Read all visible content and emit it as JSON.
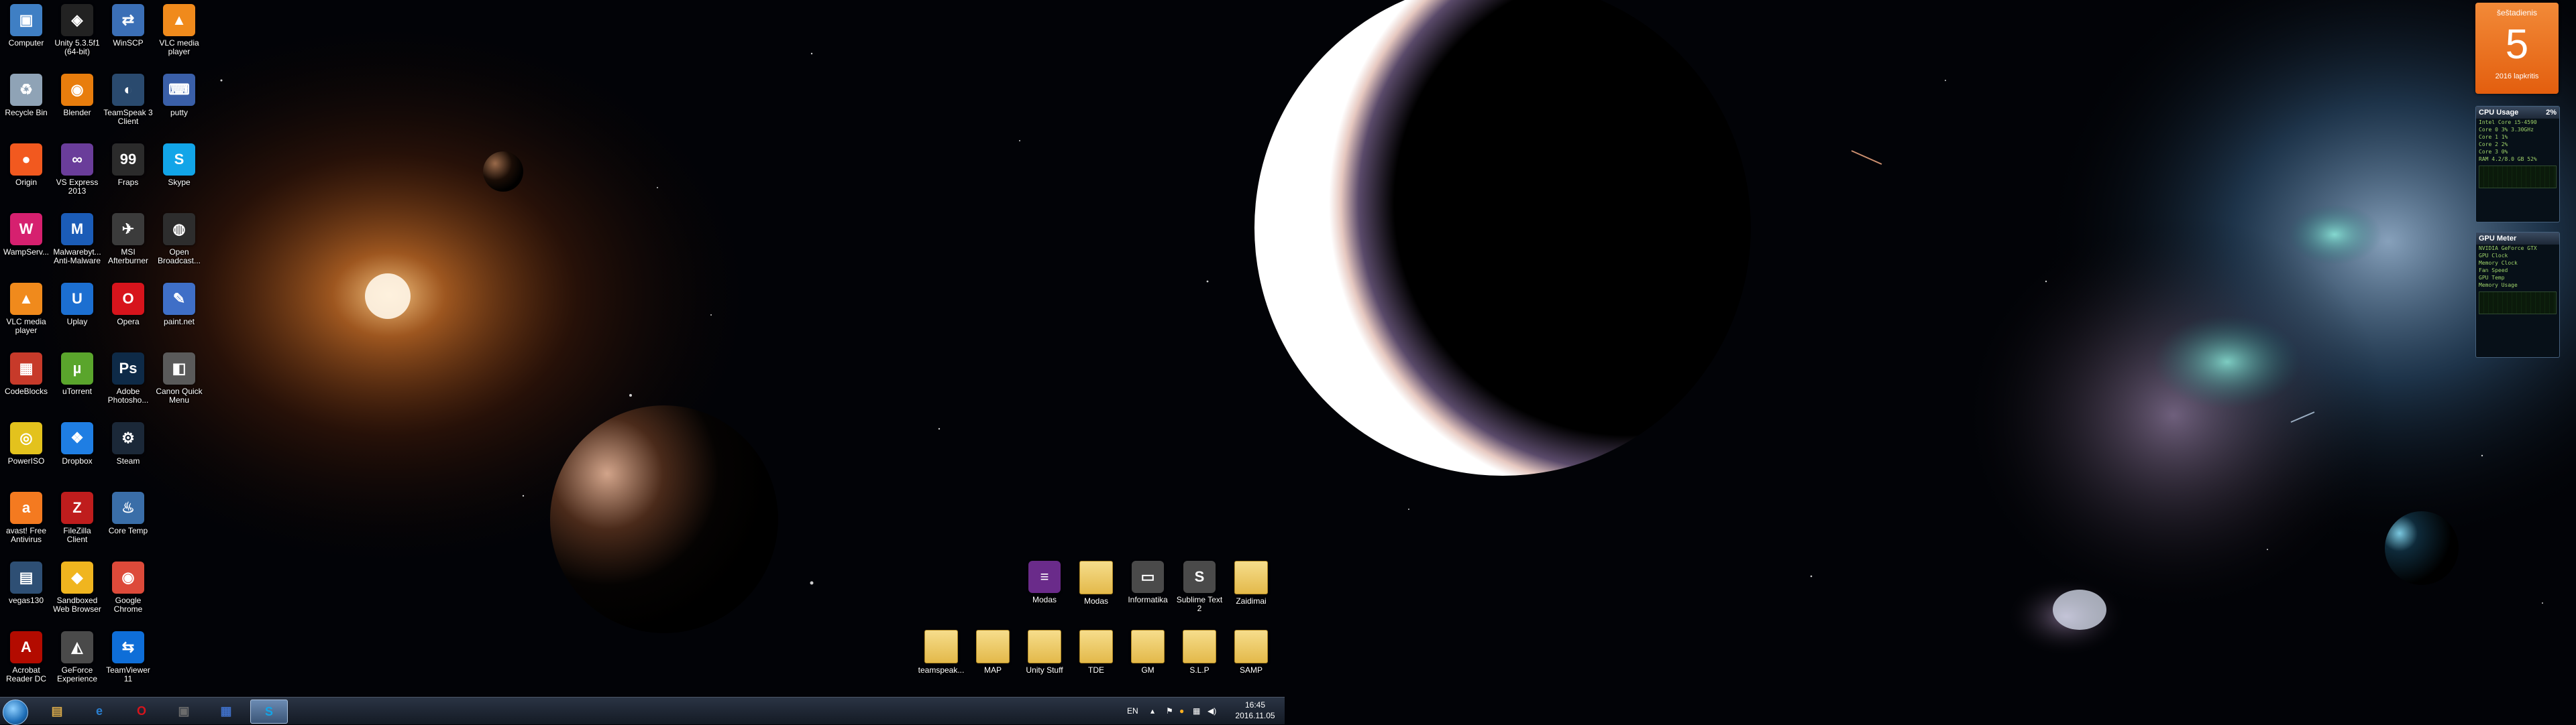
{
  "desktop": {
    "icons": [
      {
        "label": "Computer",
        "icon": "computer-icon",
        "color": "#3f7fc4",
        "glyph": "▣"
      },
      {
        "label": "Unity 5.3.5f1 (64-bit)",
        "icon": "unity-icon",
        "color": "#222222",
        "glyph": "◈"
      },
      {
        "label": "WinSCP",
        "icon": "winscp-icon",
        "color": "#3b6fb6",
        "glyph": "⇄"
      },
      {
        "label": "VLC media player",
        "icon": "vlc-icon",
        "color": "#f08a1c",
        "glyph": "▲"
      },
      {
        "label": "Recycle Bin",
        "icon": "recycle-bin-icon",
        "color": "#8fa3b6",
        "glyph": "♻"
      },
      {
        "label": "Blender",
        "icon": "blender-icon",
        "color": "#e87d0d",
        "glyph": "◉"
      },
      {
        "label": "TeamSpeak 3 Client",
        "icon": "teamspeak-icon",
        "color": "#2a4a6e",
        "glyph": "◐"
      },
      {
        "label": "putty",
        "icon": "putty-icon",
        "color": "#3a5fa8",
        "glyph": "⌨"
      },
      {
        "label": "Origin",
        "icon": "origin-icon",
        "color": "#f2591f",
        "glyph": "●"
      },
      {
        "label": "VS Express 2013",
        "icon": "visual-studio-icon",
        "color": "#6a3d9a",
        "glyph": "∞"
      },
      {
        "label": "Fraps",
        "icon": "fraps-icon",
        "color": "#2b2b2b",
        "glyph": "99"
      },
      {
        "label": "Skype",
        "icon": "skype-icon",
        "color": "#12a5e8",
        "glyph": "S"
      },
      {
        "label": "WampServ...",
        "icon": "wampserver-icon",
        "color": "#d6206f",
        "glyph": "W"
      },
      {
        "label": "Malwarebyt... Anti-Malware",
        "icon": "malwarebytes-icon",
        "color": "#1b5cb7",
        "glyph": "M"
      },
      {
        "label": "MSI Afterburner",
        "icon": "msi-afterburner-icon",
        "color": "#3b3b3b",
        "glyph": "✈"
      },
      {
        "label": "Open Broadcast...",
        "icon": "obs-icon",
        "color": "#2d2d2d",
        "glyph": "◍"
      },
      {
        "label": "VLC media player",
        "icon": "vlc-icon",
        "color": "#f08a1c",
        "glyph": "▲"
      },
      {
        "label": "Uplay",
        "icon": "uplay-icon",
        "color": "#1c6fd1",
        "glyph": "U"
      },
      {
        "label": "Opera",
        "icon": "opera-icon",
        "color": "#d7141c",
        "glyph": "O"
      },
      {
        "label": "paint.net",
        "icon": "paint-net-icon",
        "color": "#3f6fc7",
        "glyph": "✎"
      },
      {
        "label": "CodeBlocks",
        "icon": "codeblocks-icon",
        "color": "#c73a2a",
        "glyph": "▦"
      },
      {
        "label": "uTorrent",
        "icon": "utorrent-icon",
        "color": "#5aa52c",
        "glyph": "µ"
      },
      {
        "label": "Adobe Photosho...",
        "icon": "photoshop-icon",
        "color": "#0e2a47",
        "glyph": "Ps"
      },
      {
        "label": "Canon Quick Menu",
        "icon": "canon-icon",
        "color": "#5a5a5a",
        "glyph": "◧"
      },
      {
        "label": "PowerISO",
        "icon": "poweriso-icon",
        "color": "#e3c21d",
        "glyph": "◎"
      },
      {
        "label": "Dropbox",
        "icon": "dropbox-icon",
        "color": "#1f7ee3",
        "glyph": "❖"
      },
      {
        "label": "Steam",
        "icon": "steam-icon",
        "color": "#1b2838",
        "glyph": "⚙"
      },
      {
        "label": "",
        "icon": "blank",
        "color": "",
        "glyph": ""
      },
      {
        "label": "avast! Free Antivirus",
        "icon": "avast-icon",
        "color": "#f47a20",
        "glyph": "a"
      },
      {
        "label": "FileZilla Client",
        "icon": "filezilla-icon",
        "color": "#bf1d1d",
        "glyph": "Z"
      },
      {
        "label": "Core Temp",
        "icon": "core-temp-icon",
        "color": "#3a6ea8",
        "glyph": "♨"
      },
      {
        "label": "",
        "icon": "blank",
        "color": "",
        "glyph": ""
      },
      {
        "label": "vegas130",
        "icon": "vegas-icon",
        "color": "#2e4f74",
        "glyph": "▤"
      },
      {
        "label": "Sandboxed Web Browser",
        "icon": "sandboxie-icon",
        "color": "#f0b51f",
        "glyph": "◆"
      },
      {
        "label": "Google Chrome",
        "icon": "chrome-icon",
        "color": "#dd4a3a",
        "glyph": "◉"
      },
      {
        "label": "",
        "icon": "blank",
        "color": "",
        "glyph": ""
      },
      {
        "label": "Acrobat Reader DC",
        "icon": "acrobat-icon",
        "color": "#b30b00",
        "glyph": "A"
      },
      {
        "label": "GeForce Experience",
        "icon": "geforce-icon",
        "color": "#4a4a4a",
        "glyph": "◭"
      },
      {
        "label": "TeamViewer 11",
        "icon": "teamviewer-icon",
        "color": "#0e6ed8",
        "glyph": "⇆"
      },
      {
        "label": "",
        "icon": "blank",
        "color": "",
        "glyph": ""
      }
    ],
    "cluster_top": [
      {
        "label": "Modas",
        "icon": "winrar-icon",
        "type": "app",
        "color": "#6a2b8a",
        "glyph": "≡"
      },
      {
        "label": "Modas",
        "icon": "folder-icon",
        "type": "folder",
        "glyph": ""
      },
      {
        "label": "Informatika",
        "icon": "folder-icon",
        "type": "app",
        "color": "#4a4a4a",
        "glyph": "▭"
      },
      {
        "label": "Sublime Text 2",
        "icon": "sublime-icon",
        "type": "app",
        "color": "#4a4a4a",
        "glyph": "S"
      },
      {
        "label": "Zaidimai",
        "icon": "folder-icon",
        "type": "folder",
        "glyph": ""
      }
    ],
    "cluster_bottom": [
      {
        "label": "teamspeak...",
        "icon": "folder-icon",
        "type": "folder"
      },
      {
        "label": "MAP",
        "icon": "folder-icon",
        "type": "folder"
      },
      {
        "label": "Unity Stuff",
        "icon": "folder-icon",
        "type": "folder"
      },
      {
        "label": "TDE",
        "icon": "folder-icon",
        "type": "folder"
      },
      {
        "label": "GM",
        "icon": "folder-icon",
        "type": "folder"
      },
      {
        "label": "S.L.P",
        "icon": "folder-icon",
        "type": "folder"
      },
      {
        "label": "SAMP",
        "icon": "folder-icon",
        "type": "folder"
      }
    ]
  },
  "taskbar": {
    "pinned": [
      {
        "name": "windows-explorer-icon",
        "color": "#d8a94a",
        "glyph": "▤"
      },
      {
        "name": "internet-explorer-icon",
        "color": "#2a7fd0",
        "glyph": "e"
      },
      {
        "name": "opera-icon",
        "color": "#d7141c",
        "glyph": "O"
      },
      {
        "name": "media-center-icon",
        "color": "#6c6c6c",
        "glyph": "▣"
      },
      {
        "name": "paint-net-icon",
        "color": "#3f6fc7",
        "glyph": "▦"
      },
      {
        "name": "skype-icon",
        "color": "#12a5e8",
        "glyph": "S"
      }
    ],
    "language": "EN",
    "clock_time": "16:45",
    "clock_date": "2016.11.05"
  },
  "gadgets": {
    "calendar": {
      "weekday": "šeštadienis",
      "day": "5",
      "month_year": "2016 lapkritis",
      "color": "#e9681c"
    },
    "cpu_meter": {
      "title": "CPU Usage",
      "value": "2%",
      "rows": [
        "Intel Core i5-4590",
        "Core 0  3%  3.30GHz",
        "Core 1  1%",
        "Core 2  2%",
        "Core 3  0%",
        "RAM  4.2/8.0 GB  52%"
      ]
    },
    "gpu_meter": {
      "title": "GPU Meter",
      "rows": [
        "NVIDIA GeForce GTX",
        "GPU Clock",
        "Memory Clock",
        "Fan Speed",
        "GPU Temp",
        "Memory Usage"
      ]
    }
  }
}
